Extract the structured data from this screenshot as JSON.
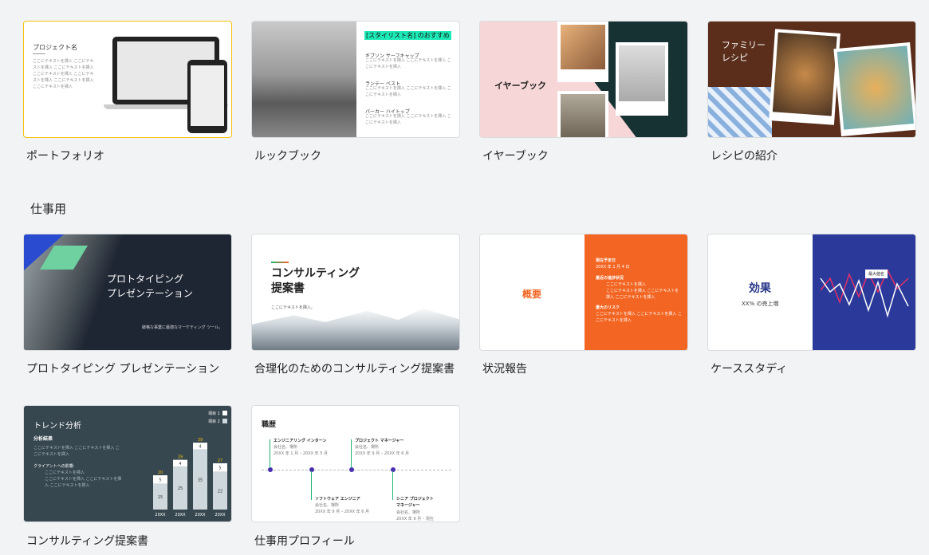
{
  "row1": [
    {
      "label": "ポートフォリオ",
      "thumb": {
        "title": "プロジェクト名",
        "body": "ここにテキストを挿入 ここにテキストを挿入 ここにテキストを挿入 ここにテキストを挿入 ここにテキストを挿入 ここにテキストを挿入 ここにテキストを挿入"
      }
    },
    {
      "label": "ルックブック",
      "thumb": {
        "heading": "[スタイリスト名] のおすすめ",
        "items": [
          {
            "title": "ギブソン サーフキャップ",
            "text": "ここにテキストを挿入 ここにテキストを挿入 ここにテキストを挿入"
          },
          {
            "title": "ランテー ベスト",
            "text": "ここにテキストを挿入 ここにテキストを挿入 ここにテキストを挿入"
          },
          {
            "title": "パーカー ハイトップ",
            "text": "ここにテキストを挿入 ここにテキストを挿入 ここにテキストを挿入"
          }
        ]
      }
    },
    {
      "label": "イヤーブック",
      "thumb": {
        "title": "イヤーブック"
      }
    },
    {
      "label": "レシピの紹介",
      "thumb": {
        "title": "ファミリー\nレシピ"
      }
    }
  ],
  "section_work": "仕事用",
  "row2": [
    {
      "label": "プロトタイピング プレゼンテーション",
      "thumb": {
        "title": "プロトタイピング\nプレゼンテーション",
        "sub": "破格な事業に最適なマーケティング ツール。"
      }
    },
    {
      "label": "合理化のためのコンサルティング提案書",
      "thumb": {
        "title": "コンサルティング\n提案書",
        "sub": "ここにテキストを挿入。"
      }
    },
    {
      "label": "状況報告",
      "thumb": {
        "title": "概要",
        "date_title": "現在予定日",
        "date": "20XX 年 1 月 4 日",
        "progress_title": "最近の進捗状況",
        "progress": [
          "ここにテキストを挿入",
          "ここにテキストを挿入 ここにテキストを挿入 ここにテキストを挿入"
        ],
        "risk_title": "最大のリスク",
        "risk": "ここにテキストを挿入 ここにテキストを挿入 ここにテキストを挿入"
      }
    },
    {
      "label": "ケーススタディ",
      "thumb": {
        "title": "効果",
        "sub": "XX% の売上増",
        "tooltip": "最大値名"
      }
    }
  ],
  "row3": [
    {
      "label": "コンサルティング提案書",
      "thumb": {
        "title": "トレンド分析",
        "sub": "分析結果",
        "text": "ここにテキストを挿入 ここにテキストを挿入 ここにテキストを挿入",
        "client": "クライアントへの影響:",
        "bullets": [
          "ここにテキストを挿入",
          "ここにテキストを挿入 ここにテキストを挿入 ここにテキストを挿入"
        ],
        "legend": [
          "項目 1",
          "項目 2"
        ]
      }
    },
    {
      "label": "仕事用プロフィール",
      "thumb": {
        "title": "職歴",
        "jobs": [
          {
            "title": "エンジニアリング インターン",
            "sub": "会社名、場所",
            "date": "20XX 年 1 月 – 20XX 年 5 月"
          },
          {
            "title": "プロジェクト マネージャー",
            "sub": "会社名、場所",
            "date": "20XX 年 9 月 – 20XX 年 6 月"
          },
          {
            "title": "ソフトウェア エンジニア",
            "sub": "会社名、場所",
            "date": "20XX 年 9 月 – 20XX 年 6 月"
          },
          {
            "title": "シニア プロジェクト\nマネージャー",
            "sub": "会社名、場所",
            "date": "20XX 年 9 月 – 現在"
          }
        ]
      }
    }
  ],
  "chart_data": {
    "type": "bar",
    "categories": [
      "20XX",
      "20XX",
      "20XX",
      "20XX"
    ],
    "series": [
      {
        "name": "項目 1",
        "values": [
          5,
          4,
          4,
          5
        ]
      },
      {
        "name": "項目 2",
        "values": [
          15,
          25,
          35,
          22
        ]
      }
    ],
    "totals": [
      20,
      29,
      39,
      27
    ]
  }
}
